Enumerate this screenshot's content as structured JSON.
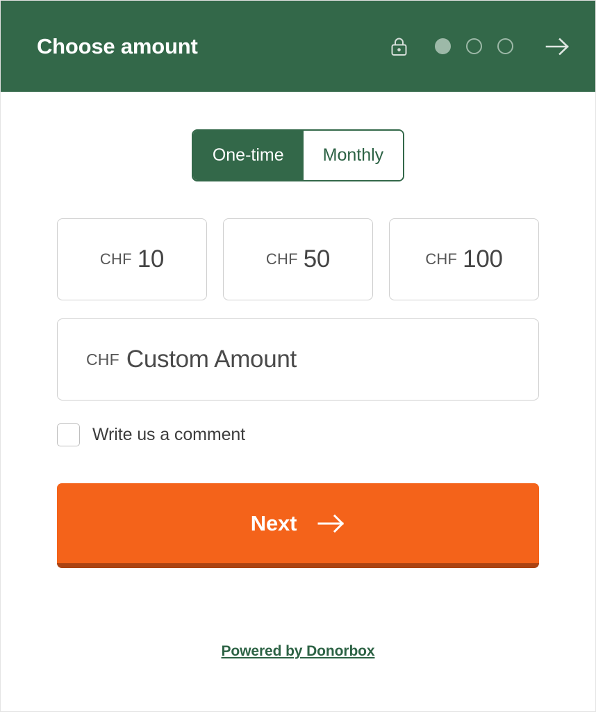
{
  "header": {
    "title": "Choose amount",
    "lock_icon": "lock-icon",
    "arrow_icon": "arrow-right-icon",
    "steps": [
      {
        "label": "1",
        "active": true
      },
      {
        "label": "2",
        "active": false
      },
      {
        "label": "3",
        "active": false
      }
    ],
    "background_color": "#336849",
    "title_color": "#ffffff",
    "dot_color": "#9db9a8"
  },
  "frequency": {
    "options": [
      {
        "label": "One-time",
        "active": true
      },
      {
        "label": "Monthly",
        "active": false
      }
    ],
    "active_bg": "#336849",
    "active_text": "#ffffff",
    "inactive_text": "#2c6244"
  },
  "amounts": {
    "currency": "CHF",
    "presets": [
      {
        "currency": "CHF",
        "value": "10"
      },
      {
        "currency": "CHF",
        "value": "50"
      },
      {
        "currency": "CHF",
        "value": "100"
      }
    ],
    "custom": {
      "currency": "CHF",
      "placeholder": "Custom Amount",
      "value": ""
    }
  },
  "comment": {
    "label": "Write us a comment",
    "checked": false
  },
  "next": {
    "label": "Next",
    "icon": "arrow-right-icon",
    "background_color": "#f4631a",
    "shadow_color": "#ab4312",
    "text_color": "#ffffff"
  },
  "footer": {
    "powered_by": "Powered by Donorbox",
    "link_color": "#2c6244"
  }
}
